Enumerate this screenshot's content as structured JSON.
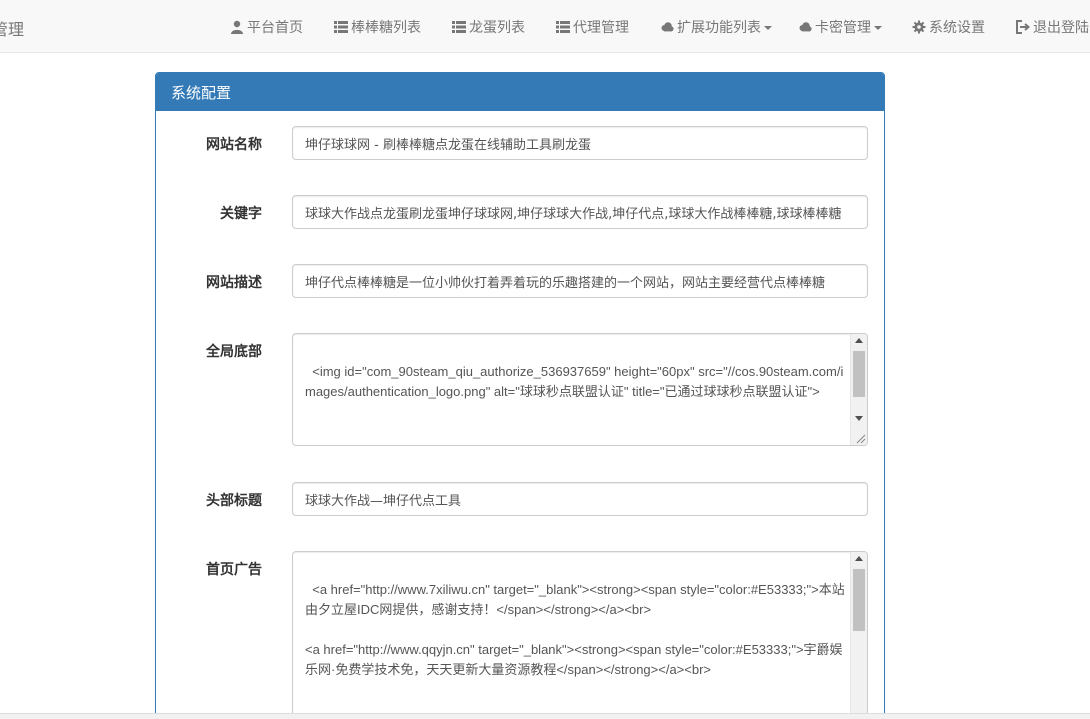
{
  "nav": {
    "brand": "管理",
    "items": [
      {
        "label": "平台首页",
        "icon": "user-icon"
      },
      {
        "label": "棒棒糖列表",
        "icon": "list-icon"
      },
      {
        "label": "龙蛋列表",
        "icon": "list-icon"
      },
      {
        "label": "代理管理",
        "icon": "list-icon"
      },
      {
        "label": "扩展功能列表",
        "icon": "cloud-icon"
      },
      {
        "label": "卡密管理",
        "icon": "cloud-icon"
      },
      {
        "label": "系统设置",
        "icon": "gear-icon"
      },
      {
        "label": "退出登陆",
        "icon": "logout-icon"
      }
    ]
  },
  "panel": {
    "title": "系统配置",
    "fields": [
      {
        "label": "网站名称",
        "value": "坤仔球球网 - 刷棒棒糖点龙蛋在线辅助工具刷龙蛋"
      },
      {
        "label": "关键字",
        "value": "球球大作战点龙蛋刷龙蛋坤仔球球网,坤仔球球大作战,坤仔代点,球球大作战棒棒糖,球球棒棒糖"
      },
      {
        "label": "网站描述",
        "value": "坤仔代点棒棒糖是一位小帅伙打着弄着玩的乐趣搭建的一个网站，网站主要经营代点棒棒糖"
      },
      {
        "label": "全局底部",
        "value": "<img id=\"com_90steam_qiu_authorize_536937659\" height=\"60px\" src=\"//cos.90steam.com/images/authentication_logo.png\" alt=\"球球秒点联盟认证\" title=\"已通过球球秒点联盟认证\">"
      },
      {
        "label": "头部标题",
        "value": "球球大作战—坤仔代点工具"
      },
      {
        "label": "首页广告",
        "value": "<a href=\"http://www.7xiliwu.cn\" target=\"_blank\"><strong><span style=\"color:#E53333;\">本站由夕立屋IDC网提供，感谢支持！</span></strong></a><br>\n\n<a href=\"http://www.qqyjn.cn\" target=\"_blank\"><strong><span style=\"color:#E53333;\">宇爵娱乐网·免费学技术免，天天更新大量资源教程</span></strong></a><br>"
      }
    ]
  },
  "colors": {
    "primary": "#337ab7",
    "navbar_bg": "#f8f8f8",
    "nav_text": "#777777"
  }
}
